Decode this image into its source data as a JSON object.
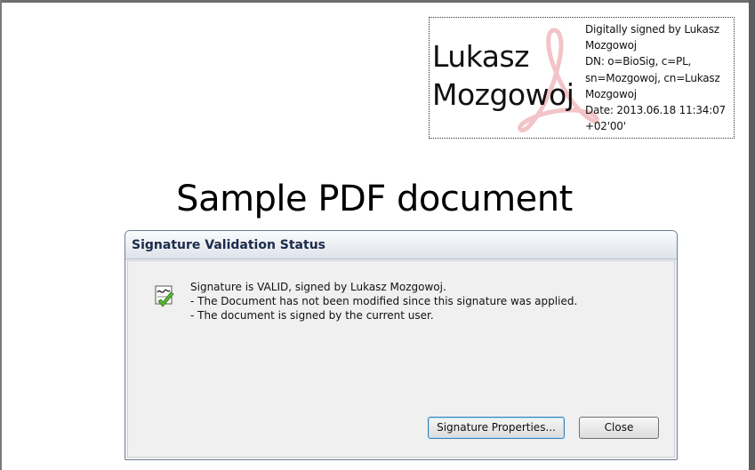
{
  "signature_block": {
    "name_line1": "Lukasz",
    "name_line2": "Mozgowoj",
    "details": [
      "Digitally signed by Lukasz",
      "Mozgowoj",
      "DN: o=BioSig, c=PL,",
      "sn=Mozgowoj, cn=Lukasz",
      "Mozgowoj",
      "Date: 2013.06.18 11:34:07",
      "+02'00'"
    ],
    "watermark_icon": "acrobat-logo-icon",
    "watermark_color": "#f2c4c8"
  },
  "document": {
    "title": "Sample PDF document"
  },
  "dialog": {
    "title": "Signature Validation Status",
    "icon": "signature-valid-icon",
    "messages": [
      "Signature is VALID, signed by Lukasz Mozgowoj.",
      "- The Document has not been modified since this signature was applied.",
      "- The document is signed by the current user."
    ],
    "buttons": {
      "properties": "Signature Properties...",
      "close": "Close"
    },
    "accent_color": "#3c7fb1"
  }
}
